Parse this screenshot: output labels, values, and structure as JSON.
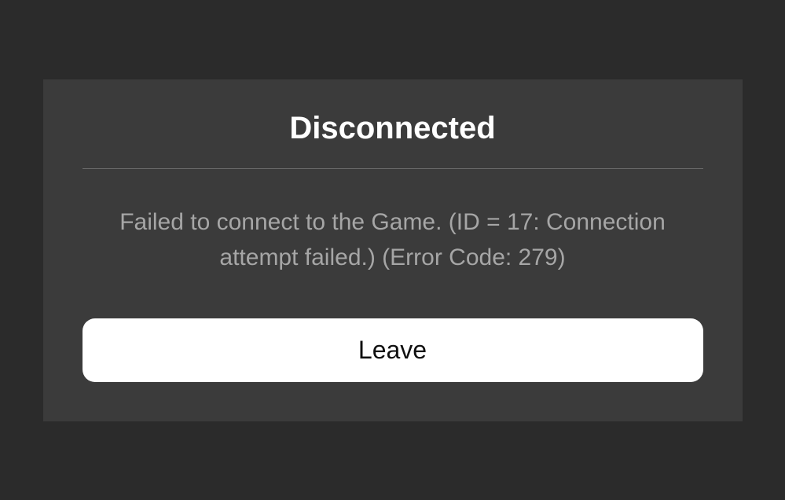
{
  "dialog": {
    "title": "Disconnected",
    "message": "Failed to connect to the Game. (ID = 17: Connection attempt failed.) (Error Code: 279)",
    "button_label": "Leave"
  }
}
